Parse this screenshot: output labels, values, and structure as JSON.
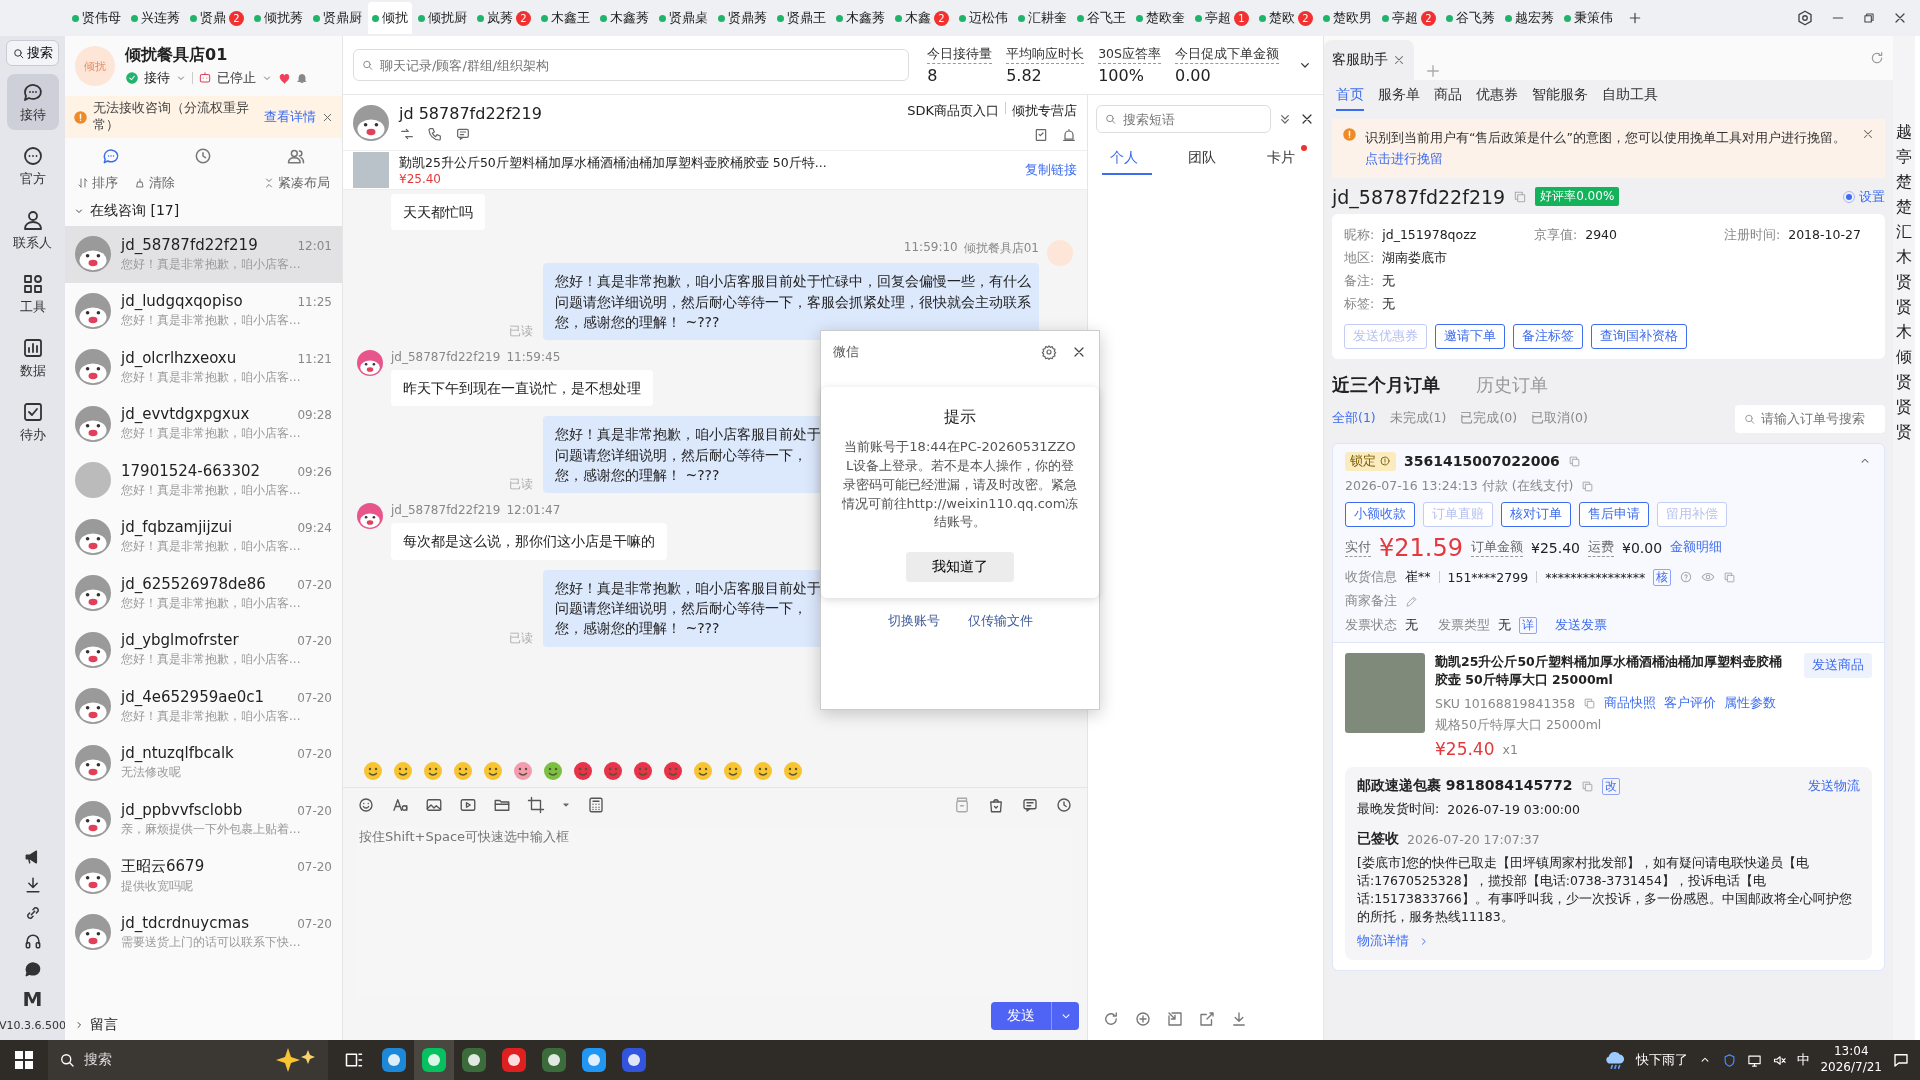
{
  "top_tabs": [
    {
      "label": "贤伟母",
      "selected": false
    },
    {
      "label": "兴连莠",
      "selected": false
    },
    {
      "label": "贤鼎",
      "badge": "2",
      "selected": false
    },
    {
      "label": "倾扰莠",
      "selected": false
    },
    {
      "label": "贤鼎厨",
      "selected": false
    },
    {
      "label": "倾扰",
      "selected": true
    },
    {
      "label": "倾扰厨",
      "selected": false
    },
    {
      "label": "岚莠",
      "badge": "2",
      "selected": false
    },
    {
      "label": "木鑫王",
      "selected": false
    },
    {
      "label": "木鑫莠",
      "selected": false
    },
    {
      "label": "贤鼎桌",
      "selected": false
    },
    {
      "label": "贤鼎莠",
      "selected": false
    },
    {
      "label": "贤鼎王",
      "selected": false
    },
    {
      "label": "木鑫莠",
      "selected": false
    },
    {
      "label": "木鑫",
      "badge": "2",
      "selected": false
    },
    {
      "label": "迈松伟",
      "selected": false
    },
    {
      "label": "汇耕奎",
      "selected": false
    },
    {
      "label": "谷飞王",
      "selected": false
    },
    {
      "label": "楚欧奎",
      "selected": false
    },
    {
      "label": "亭超",
      "badge": "1",
      "selected": false
    },
    {
      "label": "楚欧",
      "badge": "2",
      "selected": false
    },
    {
      "label": "楚欧男",
      "selected": false
    },
    {
      "label": "亭超",
      "badge": "2",
      "selected": false
    },
    {
      "label": "谷飞莠",
      "selected": false
    },
    {
      "label": "越宏莠",
      "selected": false
    },
    {
      "label": "秉策伟",
      "selected": false
    }
  ],
  "rail": {
    "search": "搜索",
    "items": [
      {
        "label": "接待",
        "kind": "chat",
        "selected": true
      },
      {
        "label": "官方",
        "kind": "comment",
        "selected": false
      },
      {
        "label": "联系人",
        "kind": "person",
        "selected": false
      },
      {
        "label": "工具",
        "kind": "grid",
        "selected": false
      },
      {
        "label": "数据",
        "kind": "chart",
        "selected": false
      },
      {
        "label": "待办",
        "kind": "todo",
        "selected": false
      }
    ],
    "logo_letter": "M",
    "version": "V10.3.6.500"
  },
  "shop": {
    "avatar_text": "倾扰",
    "name": "倾扰餐具店01",
    "status": "接待",
    "stopped": "已停止"
  },
  "alert": {
    "text": "无法接收咨询（分流权重异常）",
    "link": "查看详情"
  },
  "list_actions": {
    "sort": "排序",
    "clear": "清除",
    "compact": "紧凑布局"
  },
  "online_group": {
    "title": "在线咨询 [17]",
    "expanded": true
  },
  "conversations": [
    {
      "name": "jd_58787fd22f219",
      "time": "12:01",
      "preview": "您好！真是非常抱歉，咱小店客...",
      "kind": "mascot",
      "selected": true
    },
    {
      "name": "jd_ludgqxqopiso",
      "time": "11:25",
      "preview": "您好！真是非常抱歉，咱小店客...",
      "kind": "mascot",
      "selected": false
    },
    {
      "name": "jd_olcrlhzxeoxu",
      "time": "11:21",
      "preview": "您好！真是非常抱歉，咱小店客...",
      "kind": "mascot",
      "selected": false
    },
    {
      "name": "jd_evvtdgxpgxux",
      "time": "09:28",
      "preview": "您好！真是非常抱歉，咱小店客...",
      "kind": "mascot",
      "selected": false
    },
    {
      "name": "17901524-663302",
      "time": "09:26",
      "preview": "您好！真是非常抱歉，咱小店客...",
      "kind": "photo",
      "selected": false
    },
    {
      "name": "jd_fqbzamjijzui",
      "time": "09:24",
      "preview": "您好！真是非常抱歉，咱小店客...",
      "kind": "mascot",
      "selected": false
    },
    {
      "name": "jd_625526978de86",
      "time": "07-20",
      "preview": "您好！真是非常抱歉，咱小店客...",
      "kind": "mascot",
      "selected": false
    },
    {
      "name": "jd_ybglmofrster",
      "time": "07-20",
      "preview": "您好！真是非常抱歉，咱小店客...",
      "kind": "mascot",
      "selected": false
    },
    {
      "name": "jd_4e652959ae0c1",
      "time": "07-20",
      "preview": "您好！真是非常抱歉，咱小店客...",
      "kind": "mascot",
      "selected": false
    },
    {
      "name": "jd_ntuzqlfbcalk",
      "time": "07-20",
      "preview": "无法修改呢",
      "kind": "mascot",
      "selected": false
    },
    {
      "name": "jd_ppbvvfsclobb",
      "time": "07-20",
      "preview": "亲，麻烦提供一下外包裹上贴着...",
      "kind": "mascot",
      "selected": false
    },
    {
      "name": "王昭云6679",
      "time": "07-20",
      "preview": "提供收宽吗呢",
      "kind": "mascot",
      "selected": false
    },
    {
      "name": "jd_tdcrdnuycmas",
      "time": "07-20",
      "preview": "需要送货上门的话可以联系下快...",
      "kind": "mascot",
      "selected": false
    }
  ],
  "message_group": {
    "title": "留言",
    "expanded": false
  },
  "search": {
    "placeholder": "聊天记录/顾客/群组/组织架构"
  },
  "stats": [
    {
      "label": "今日接待量",
      "value": "8"
    },
    {
      "label": "平均响应时长",
      "value": "5.82"
    },
    {
      "label": "30S应答率",
      "value": "100%"
    },
    {
      "label": "今日促成下单金额",
      "value": "0.00"
    }
  ],
  "chat": {
    "customer": "jd 58787fd22f219",
    "source": "SDK商品页入口",
    "store": "倾扰专营店",
    "product": {
      "title": "勤凯25升公斤50斤塑料桶加厚水桶酒桶油桶加厚塑料壶胶桶胶壶 50斤特...",
      "price": "¥25.40",
      "link": "复制链接"
    },
    "messages": [
      {
        "kind": "customer",
        "lines": [
          "天天都忙吗"
        ]
      },
      {
        "kind": "agent",
        "time": "11:59:10",
        "sender": "倾扰餐具店01",
        "lines": [
          "您好！真是非常抱歉，咱小店客服目前处于忙碌中，回复会偏慢一些，有什么",
          "问题请您详细说明，然后耐心等待一下，客服会抓紧处理，很快就会主动联系",
          "您，感谢您的理解！ ~???"
        ],
        "read": "已读"
      },
      {
        "kind": "customer",
        "sender": "jd_58787fd22f219",
        "time": "11:59:45",
        "lines": [
          "昨天下午到现在一直说忙，是不想处理"
        ]
      },
      {
        "kind": "agent",
        "lines": [
          "您好！真是非常抱歉，咱小店客服目前处于",
          "问题请您详细说明，然后耐心等待一下，",
          "您，感谢您的理解！ ~???"
        ],
        "read": "已读"
      },
      {
        "kind": "customer",
        "sender": "jd_58787fd22f219",
        "time": "12:01:47",
        "lines": [
          "每次都是这么说，那你们这小店是干嘛的"
        ]
      },
      {
        "kind": "agent",
        "lines": [
          "您好！真是非常抱歉，咱小店客服目前处于",
          "问题请您详细说明，然后耐心等待一下，",
          "您，感谢您的理解！ ~???"
        ],
        "read": "已读"
      }
    ],
    "input_placeholder": "按住Shift+Space可快速选中输入框",
    "send": "发送"
  },
  "phrases": {
    "placeholder": "搜索短语",
    "tabs": [
      {
        "label": "个人",
        "selected": true,
        "dot": false
      },
      {
        "label": "团队",
        "selected": false,
        "dot": false
      },
      {
        "label": "卡片",
        "selected": false,
        "dot": true
      }
    ]
  },
  "dialog": {
    "title": "微信",
    "heading": "提示",
    "body": "当前账号于18:44在PC-20260531ZZOL设备上登录。若不是本人操作，你的登录密码可能已经泄漏，请及时改密。紧急情况可前往http://weixin110.qq.com冻结账号。",
    "button": "我知道了",
    "links": [
      "切换账号",
      "仅传输文件"
    ]
  },
  "assistant": {
    "tab": "客服助手",
    "nav": [
      {
        "label": "首页",
        "selected": true
      },
      {
        "label": "服务单",
        "selected": false
      },
      {
        "label": "商品",
        "selected": false
      },
      {
        "label": "优惠券",
        "selected": false
      },
      {
        "label": "智能服务",
        "selected": false
      },
      {
        "label": "自助工具",
        "selected": false
      }
    ],
    "notice": {
      "text": "识别到当前用户有“售后政策是什么”的意图，您可以使用挽单工具对用户进行挽留。",
      "link": "点击进行挽留"
    },
    "user": {
      "name": "jd_58787fd22f219",
      "rating": "好评率0.00%",
      "setting": "设置",
      "setting_on": true
    },
    "fields": [
      [
        {
          "label": "昵称:",
          "value": "jd_151978qozz"
        },
        {
          "label": "京享值:",
          "value": "2940"
        },
        {
          "label": "注册时间:",
          "value": "2018-10-27"
        }
      ],
      [
        {
          "label": "地区:",
          "value": "湖南娄底市"
        }
      ],
      [
        {
          "label": "备注:",
          "value": "无"
        }
      ],
      [
        {
          "label": "标签:",
          "value": "无"
        }
      ]
    ],
    "actions": [
      {
        "label": "发送优惠券",
        "disabled": true
      },
      {
        "label": "邀请下单",
        "disabled": false
      },
      {
        "label": "备注标签",
        "disabled": false
      },
      {
        "label": "查询国补资格",
        "disabled": false
      }
    ],
    "order_tabs": [
      {
        "label": "近三个月订单",
        "selected": true
      },
      {
        "label": "历史订单",
        "selected": false
      }
    ],
    "filters": [
      {
        "label": "全部(1)",
        "selected": true
      },
      {
        "label": "未完成(1)",
        "selected": false
      },
      {
        "label": "已完成(0)",
        "selected": false
      },
      {
        "label": "已取消(0)",
        "selected": false
      }
    ],
    "order_search": {
      "placeholder": "请输入订单号搜索"
    },
    "order": {
      "lock": "锁定",
      "number": "3561415007022006",
      "paid_time": "2026-07-16 13:24:13 付款 (在线支付)",
      "buttons": [
        {
          "label": "小额收款",
          "disabled": false
        },
        {
          "label": "订单直赔",
          "disabled": true
        },
        {
          "label": "核对订单",
          "disabled": false
        },
        {
          "label": "售后申请",
          "disabled": false
        },
        {
          "label": "留用补偿",
          "disabled": true
        }
      ],
      "paid_label": "实付",
      "paid": "¥21.59",
      "total_label": "订单金额",
      "total": "¥25.40",
      "ship_label": "运费",
      "ship": "¥0.00",
      "detail": "金额明细",
      "receiver": {
        "label": "收货信息",
        "name": "崔**",
        "phone": "151****2799",
        "address": "****************",
        "verify": "核"
      },
      "remark": "商家备注",
      "invoice": {
        "status_label": "发票状态",
        "status": "无",
        "type_label": "发票类型",
        "type": "无",
        "detail": "详",
        "send": "发送发票"
      },
      "item": {
        "title": "勤凯25升公斤50斤塑料桶加厚水桶酒桶油桶加厚塑料壶胶桶胶壶 50斤特厚大口 25000ml",
        "send": "发送商品",
        "sku": "SKU 10168819841358",
        "links": [
          "商品快照",
          "客户评价",
          "属性参数"
        ],
        "spec": "规格50斤特厚大口 25000ml",
        "price": "¥25.40",
        "qty": "x1"
      },
      "shipment": {
        "title": "邮政速递包裹 9818084145772",
        "change": "改",
        "send": "发送物流",
        "deadline_label": "最晚发货时间:",
        "deadline": "2026-07-19 03:00:00",
        "status": "已签收",
        "status_time": "2026-07-20 17:07:37",
        "trace": "[娄底市]您的快件已取走【田坪镇周家村批发部】，如有疑问请电联快递员【电话:17670525328】，揽投部【电话:0738-3731454】，投诉电话【电话:15173833766】。有事呼叫我，少一次投诉，多一份感恩。中国邮政将全心呵护您的所托，服务热线11183。",
        "detail": "物流详情"
      }
    }
  },
  "edge_tabs": [
    "越",
    "亭",
    "楚",
    "楚",
    "汇",
    "木",
    "贤",
    "贤",
    "木",
    "倾",
    "贤",
    "贤",
    "贤"
  ],
  "taskbar": {
    "search": "搜索",
    "weather": "快下雨了",
    "ime": "中",
    "time": "13:04",
    "date": "2026/7/21"
  }
}
